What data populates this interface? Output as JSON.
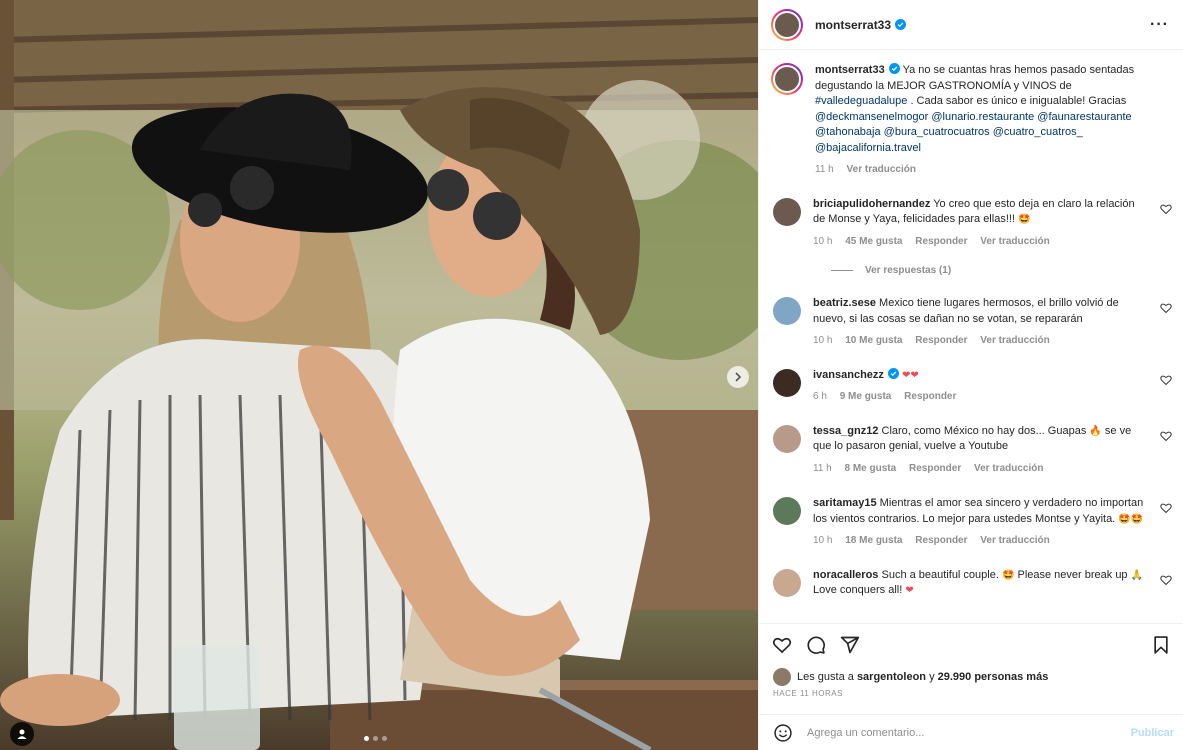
{
  "post": {
    "username": "montserrat33",
    "verified": true,
    "carousel": {
      "slide_count": 3,
      "active_index": 0
    }
  },
  "caption": {
    "username": "montserrat33",
    "text_1": "Ya no se cuantas hras hemos pasado sentadas degustando la MEJOR GASTRONOMÍA y VINOS de",
    "hashtag": "#valledeguadalupe",
    "text_2": ". Cada sabor es único e inigualable! Gracias",
    "mentions": [
      "@deckmansenelmogor",
      "@lunario.restaurante",
      "@faunarestaurante",
      "@tahonabaja",
      "@bura_cuatrocuatros",
      "@cuatro_cuatros_",
      "@bajacalifornia.travel"
    ],
    "time": "11 h",
    "translate": "Ver traducción"
  },
  "labels": {
    "likes_suffix": "Me gusta",
    "reply": "Responder",
    "translate": "Ver traducción",
    "view_replies": "Ver respuestas (1)"
  },
  "comments": [
    {
      "username": "briciapulidohernandez",
      "text": "Yo creo que esto deja en claro la relación de Monse y Yaya, felicidades para ellas!!!",
      "emoji": "🤩",
      "time": "10 h",
      "likes": "45 Me gusta",
      "translate": true,
      "avatar_color": "#6d5a4f"
    },
    {
      "username": "beatriz.sese",
      "text": "Mexico tiene lugares hermosos, el brillo volvió de nuevo, si las cosas se dañan no se votan, se repararán",
      "emoji": "",
      "time": "10 h",
      "likes": "10 Me gusta",
      "translate": true,
      "avatar_color": "#7fa6c4"
    },
    {
      "username": "ivansanchezz",
      "verified": true,
      "text": "",
      "emoji": "❤❤",
      "time": "6 h",
      "likes": "9 Me gusta",
      "translate": false,
      "avatar_color": "#3b2b22"
    },
    {
      "username": "tessa_gnz12",
      "text": "Claro, como México no hay dos... Guapas",
      "emoji": "🔥",
      "text_after": "se ve que lo pasaron genial, vuelve a Youtube",
      "time": "11 h",
      "likes": "8 Me gusta",
      "translate": true,
      "avatar_color": "#b89a8a"
    },
    {
      "username": "saritamay15",
      "text": "Mientras el amor sea sincero y verdadero no importan los vientos contrarios. Lo mejor para ustedes Montse y Yayita.",
      "emoji": "🤩🤩",
      "time": "10 h",
      "likes": "18 Me gusta",
      "translate": true,
      "avatar_color": "#5c7a5a"
    },
    {
      "username": "noracalleros",
      "text": "Such a beautiful couple.",
      "emoji": "🤩",
      "text_after": "Please never break up",
      "emoji_2": "🙏",
      "text_end": "Love conquers all!",
      "emoji_3": "❤",
      "avatar_color": "#c8a890"
    }
  ],
  "likes_line": {
    "prefix": "Les gusta a",
    "user": "sargentoleon",
    "connector": "y",
    "others": "29.990 personas más"
  },
  "time_ago": "HACE 11 HORAS",
  "add_comment": {
    "placeholder": "Agrega un comentario...",
    "post_label": "Publicar"
  },
  "colors": {
    "link": "#00376b",
    "muted": "#8e8e8e",
    "post_disabled": "#b2dffc",
    "verified": "#0095f6",
    "heart_red": "#ed4956"
  }
}
